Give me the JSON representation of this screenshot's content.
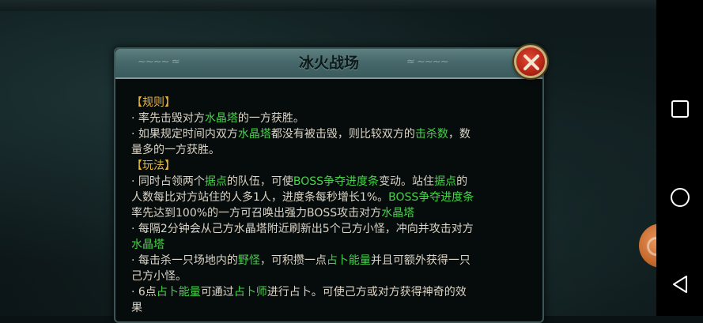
{
  "dialog": {
    "title": "冰火战场",
    "close_icon": "close-x-icon",
    "ornament_left": "~~~~ ≈",
    "ornament_right": "≈ ~~~~"
  },
  "lines": [
    [
      {
        "t": "【规则】",
        "c": "heading"
      }
    ],
    [
      {
        "t": "· 率先击毁对方"
      },
      {
        "t": "水晶塔",
        "c": "hl"
      },
      {
        "t": "的一方获胜。"
      }
    ],
    [
      {
        "t": "· 如果规定时间内双方"
      },
      {
        "t": "水晶塔",
        "c": "hl"
      },
      {
        "t": "都没有被击毁，则比较双方的"
      },
      {
        "t": "击杀数",
        "c": "hl"
      },
      {
        "t": "，数"
      }
    ],
    [
      {
        "t": "量多的一方获胜。"
      }
    ],
    [
      {
        "t": "【玩法】",
        "c": "heading"
      }
    ],
    [
      {
        "t": "· 同时占领两个"
      },
      {
        "t": "据点",
        "c": "hl"
      },
      {
        "t": "的队伍，可使"
      },
      {
        "t": "BOSS争夺进度条",
        "c": "hl"
      },
      {
        "t": "变动。站住"
      },
      {
        "t": "据点",
        "c": "hl"
      },
      {
        "t": "的"
      }
    ],
    [
      {
        "t": "人数每比对方站住的人多1人，进度条每秒增长1%。"
      },
      {
        "t": "BOSS争夺进度条",
        "c": "hl"
      }
    ],
    [
      {
        "t": "率先达到100%的一方可召唤出强力BOSS攻击对方"
      },
      {
        "t": "水晶塔",
        "c": "hl"
      }
    ],
    [
      {
        "t": "· 每隔2分钟会从己方水晶塔附近刷新出5个己方小怪，冲向并攻击对方"
      }
    ],
    [
      {
        "t": "水晶塔",
        "c": "hl"
      }
    ],
    [
      {
        "t": "· 每击杀一只场地内的"
      },
      {
        "t": "野怪",
        "c": "hl"
      },
      {
        "t": "，可积攒一点"
      },
      {
        "t": "占卜能量",
        "c": "hl"
      },
      {
        "t": "并且可额外获得一只"
      }
    ],
    [
      {
        "t": "己方小怪。"
      }
    ],
    [
      {
        "t": "· 6点"
      },
      {
        "t": "占卜能量",
        "c": "hl"
      },
      {
        "t": "可通过"
      },
      {
        "t": "占卜师",
        "c": "hl"
      },
      {
        "t": "进行占卜。可使己方或对方获得神奇的效"
      }
    ],
    [
      {
        "t": "果"
      }
    ]
  ],
  "colors": {
    "text": "#dcd6c8",
    "heading": "#e6b73c",
    "highlight": "#46d449",
    "header_bg": "#4d6f70",
    "close_red": "#c0301f"
  },
  "nav": {
    "recents_icon": "square-recents-icon",
    "home_icon": "circle-home-icon",
    "back_icon": "triangle-back-icon"
  }
}
